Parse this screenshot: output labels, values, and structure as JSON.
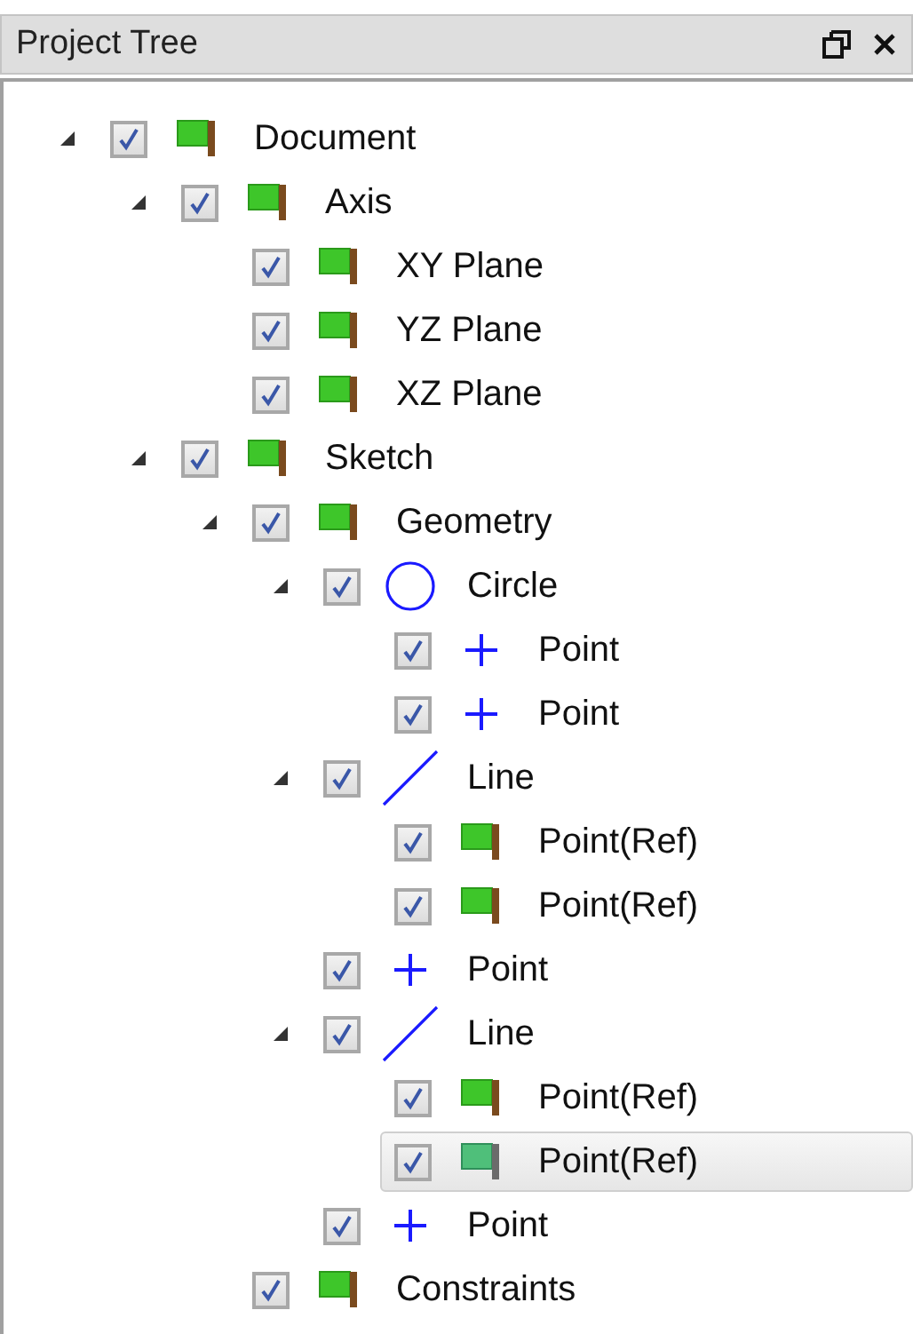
{
  "panel": {
    "title": "Project Tree"
  },
  "tree": [
    {
      "label": "Document",
      "kind": "flag",
      "checked": true,
      "selected": false,
      "expanded": true,
      "children": [
        {
          "label": "Axis",
          "kind": "flag",
          "checked": true,
          "selected": false,
          "expanded": true,
          "children": [
            {
              "label": "XY Plane",
              "kind": "flag",
              "checked": true,
              "selected": false
            },
            {
              "label": "YZ Plane",
              "kind": "flag",
              "checked": true,
              "selected": false
            },
            {
              "label": "XZ Plane",
              "kind": "flag",
              "checked": true,
              "selected": false
            }
          ]
        },
        {
          "label": "Sketch",
          "kind": "flag",
          "checked": true,
          "selected": false,
          "expanded": true,
          "children": [
            {
              "label": "Geometry",
              "kind": "flag",
              "checked": true,
              "selected": false,
              "expanded": true,
              "children": [
                {
                  "label": "Circle",
                  "kind": "circle",
                  "checked": true,
                  "selected": false,
                  "expanded": true,
                  "children": [
                    {
                      "label": "Point",
                      "kind": "point",
                      "checked": true,
                      "selected": false
                    },
                    {
                      "label": "Point",
                      "kind": "point",
                      "checked": true,
                      "selected": false
                    }
                  ]
                },
                {
                  "label": "Line",
                  "kind": "line",
                  "checked": true,
                  "selected": false,
                  "expanded": true,
                  "children": [
                    {
                      "label": "Point(Ref)",
                      "kind": "flag",
                      "checked": true,
                      "selected": false
                    },
                    {
                      "label": "Point(Ref)",
                      "kind": "flag",
                      "checked": true,
                      "selected": false
                    }
                  ]
                },
                {
                  "label": "Point",
                  "kind": "point",
                  "checked": true,
                  "selected": false
                },
                {
                  "label": "Line",
                  "kind": "line",
                  "checked": true,
                  "selected": false,
                  "expanded": true,
                  "children": [
                    {
                      "label": "Point(Ref)",
                      "kind": "flag",
                      "checked": true,
                      "selected": false
                    },
                    {
                      "label": "Point(Ref)",
                      "kind": "flag",
                      "checked": true,
                      "selected": true
                    }
                  ]
                },
                {
                  "label": "Point",
                  "kind": "point",
                  "checked": true,
                  "selected": false
                }
              ]
            },
            {
              "label": "Constraints",
              "kind": "flag",
              "checked": true,
              "selected": false
            }
          ]
        }
      ]
    }
  ]
}
